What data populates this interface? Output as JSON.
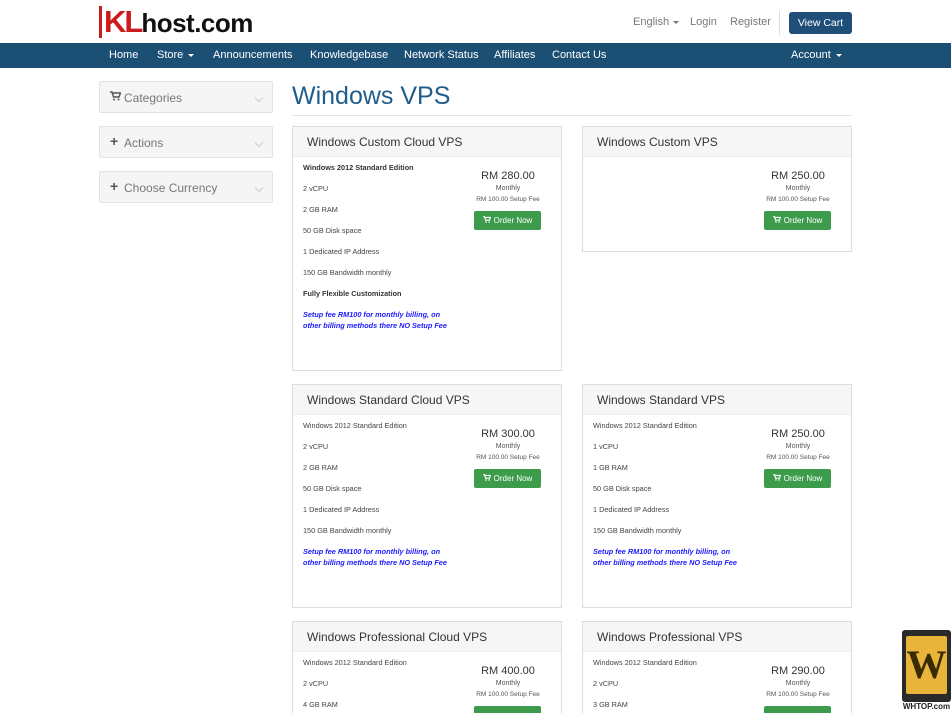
{
  "header": {
    "logo_kl": "KL",
    "logo_rest": "host.com",
    "language": "English",
    "login": "Login",
    "register": "Register",
    "view_cart": "View Cart"
  },
  "nav": {
    "items": [
      "Home",
      "Store",
      "Announcements",
      "Knowledgebase",
      "Network Status",
      "Affiliates",
      "Contact Us"
    ],
    "account": "Account"
  },
  "sidebar": {
    "panels": [
      {
        "icon": "cart-icon",
        "label": "Categories"
      },
      {
        "icon": "plus-icon",
        "label": "Actions"
      },
      {
        "icon": "plus-icon",
        "label": "Choose Currency"
      }
    ]
  },
  "page": {
    "title": "Windows VPS"
  },
  "order_label": "Order Now",
  "products": [
    {
      "name": "Windows Custom Cloud VPS",
      "features": [
        "Windows 2012 Standard Edition",
        "2 vCPU",
        "2 GB RAM",
        "50 GB Disk space",
        "1 Dedicated IP Address",
        "150 GB Bandwidth monthly",
        "Fully Flexible Customization"
      ],
      "note": "Setup fee RM100 for monthly billing, on other billing methods there NO Setup Fee",
      "price": "RM 280.00",
      "cycle": "Monthly",
      "setup": "RM 100.00 Setup Fee"
    },
    {
      "name": "Windows Custom VPS",
      "features": [],
      "note": "",
      "price": "RM 250.00",
      "cycle": "Monthly",
      "setup": "RM 100.00 Setup Fee"
    },
    {
      "name": "Windows Standard Cloud VPS",
      "features": [
        "Windows 2012 Standard Edition",
        "2 vCPU",
        "2 GB RAM",
        "50 GB Disk space",
        "1 Dedicated IP Address",
        "150 GB Bandwidth monthly"
      ],
      "note": "Setup fee RM100 for monthly billing, on other billing methods there NO Setup Fee",
      "price": "RM 300.00",
      "cycle": "Monthly",
      "setup": "RM 100.00 Setup Fee"
    },
    {
      "name": "Windows Standard VPS",
      "features": [
        "Windows 2012 Standard Edition",
        "1 vCPU",
        "1 GB RAM",
        "50 GB Disk space",
        "1 Dedicated IP Address",
        "150 GB Bandwidth monthly"
      ],
      "note": "Setup fee RM100 for monthly billing, on other billing methods there NO Setup Fee",
      "price": "RM 250.00",
      "cycle": "Monthly",
      "setup": "RM 100.00 Setup Fee"
    },
    {
      "name": "Windows Professional Cloud VPS",
      "features": [
        "Windows 2012 Standard Edition",
        "2 vCPU",
        "4 GB RAM"
      ],
      "note": "",
      "price": "RM 400.00",
      "cycle": "Monthly",
      "setup": "RM 100.00 Setup Fee"
    },
    {
      "name": "Windows Professional VPS",
      "features": [
        "Windows 2012 Standard Edition",
        "2 vCPU",
        "3 GB RAM"
      ],
      "note": "",
      "price": "RM 290.00",
      "cycle": "Monthly",
      "setup": "RM 100.00 Setup Fee"
    }
  ],
  "watermark": {
    "glyph": "W",
    "text": "WHTOP.com"
  }
}
